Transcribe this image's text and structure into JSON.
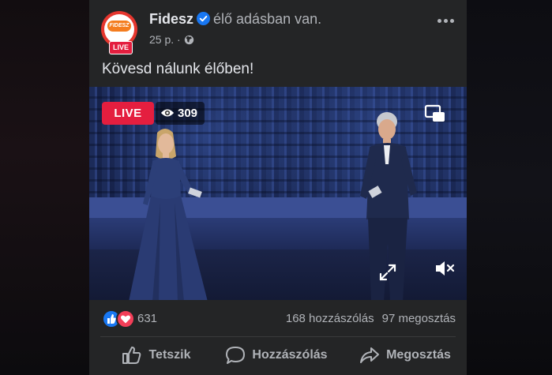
{
  "post": {
    "page_name": "Fidesz",
    "status": "élő adásban van.",
    "time": "25 p.",
    "separator": "·",
    "audience_icon": "globe-icon",
    "avatar_logo": "FIDESZ",
    "avatar_live": "LIVE",
    "text": "Kövesd nálunk élőben!"
  },
  "video": {
    "live_label": "LIVE",
    "viewer_count": "309"
  },
  "engagement": {
    "reaction_count": "631",
    "comments": "168 hozzászólás",
    "shares": "97 megosztás"
  },
  "actions": {
    "like": "Tetszik",
    "comment": "Hozzászólás",
    "share": "Megosztás"
  },
  "colors": {
    "live_red": "#e41e3f",
    "verified_blue": "#1877f2",
    "card_bg": "#242526"
  }
}
